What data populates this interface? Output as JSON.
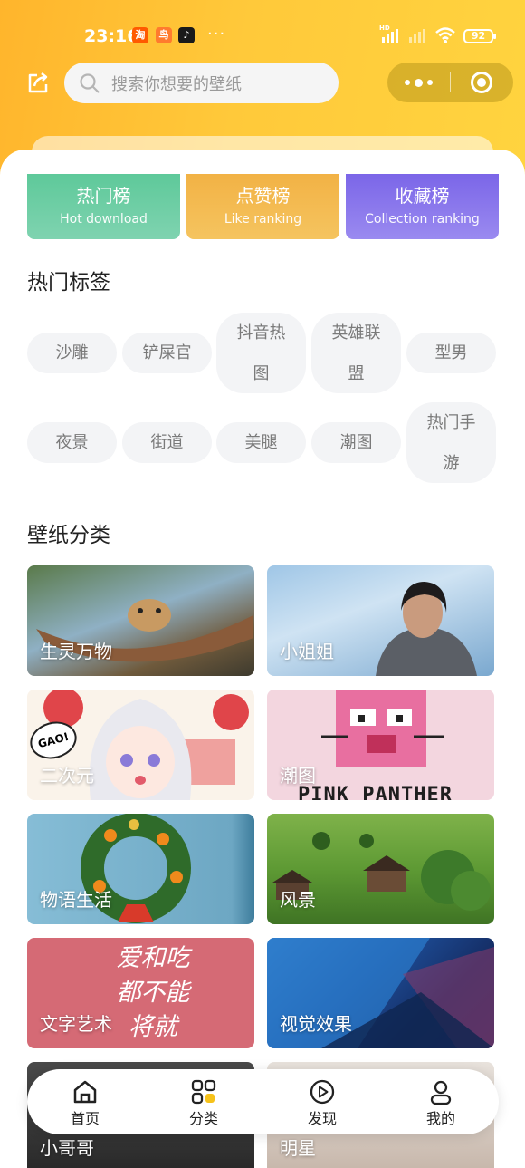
{
  "status_bar": {
    "time": "23:16",
    "apps": [
      "淘",
      "鸟",
      "♪"
    ],
    "more": "···",
    "network": "HD",
    "battery": "92"
  },
  "header": {
    "search_placeholder": "搜索你想要的壁纸",
    "share_icon": "share-icon",
    "menu_icon": "more-dots-icon",
    "close_icon": "miniapp-close-icon"
  },
  "rankings": [
    {
      "title": "热门榜",
      "subtitle": "Hot download",
      "color": "#62c99c"
    },
    {
      "title": "点赞榜",
      "subtitle": "Like ranking",
      "color": "#f3b94d"
    },
    {
      "title": "收藏榜",
      "subtitle": "Collection ranking",
      "color": "#8370ea"
    }
  ],
  "hot_tags": {
    "title": "热门标签",
    "tags": [
      "沙雕",
      "铲屎官",
      "抖音热图",
      "英雄联盟",
      "型男",
      "夜景",
      "街道",
      "美腿",
      "潮图",
      "热门手游"
    ]
  },
  "categories": {
    "title": "壁纸分类",
    "items": [
      {
        "label": "生灵万物"
      },
      {
        "label": "小姐姐"
      },
      {
        "label": "二次元",
        "badge": "GAO!"
      },
      {
        "label": "潮图",
        "art_text": "PINK PANTHER"
      },
      {
        "label": "物语生活"
      },
      {
        "label": "风景"
      },
      {
        "label": "文字艺术",
        "art_text": "爱和吃 都不能 将就"
      },
      {
        "label": "视觉效果"
      },
      {
        "label": "小哥哥"
      },
      {
        "label": "明星"
      }
    ]
  },
  "bottom_nav": [
    {
      "label": "首页",
      "icon": "home-icon"
    },
    {
      "label": "分类",
      "icon": "grid-icon",
      "active": true
    },
    {
      "label": "发现",
      "icon": "play-circle-icon"
    },
    {
      "label": "我的",
      "icon": "user-icon"
    }
  ],
  "colors": {
    "header_gradient_start": "#ffb52c",
    "header_gradient_end": "#ffd43f",
    "tag_bg": "#f3f4f6",
    "accent_yellow": "#f6c21a"
  }
}
